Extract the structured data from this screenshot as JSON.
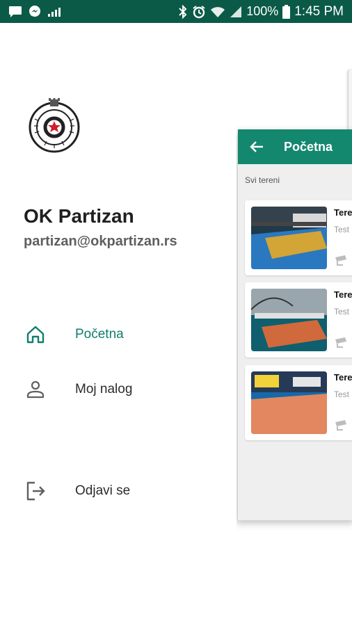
{
  "status_bar": {
    "battery": "100%",
    "time": "1:45 PM"
  },
  "profile": {
    "name": "OK Partizan",
    "email": "partizan@okpartizan.rs"
  },
  "menu": {
    "items": [
      {
        "label": "Početna",
        "icon": "home-icon",
        "active": true
      },
      {
        "label": "Moj nalog",
        "icon": "user-icon",
        "active": false
      },
      {
        "label": "Odjavi se",
        "icon": "logout-icon",
        "active": false
      }
    ]
  },
  "app_preview": {
    "title": "Početna",
    "section": "Svi tereni",
    "cards": [
      {
        "title": "Teren",
        "subtitle": "Test"
      },
      {
        "title": "Teren",
        "subtitle": "Test"
      },
      {
        "title": "Teren",
        "subtitle": "Test"
      }
    ]
  },
  "colors": {
    "status_bar": "#0a5a47",
    "primary": "#14876f",
    "active_text": "#0f7f6a"
  }
}
